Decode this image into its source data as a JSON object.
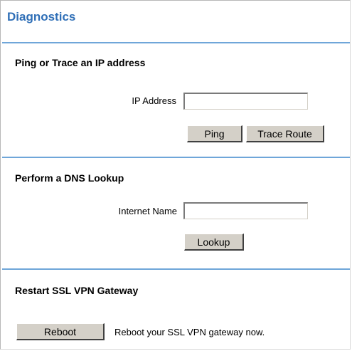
{
  "page": {
    "title": "Diagnostics"
  },
  "ping_section": {
    "title": "Ping or Trace an IP address",
    "ip_label": "IP Address",
    "ip_value": "",
    "ping_button": "Ping",
    "trace_button": "Trace Route"
  },
  "dns_section": {
    "title": "Perform a DNS Lookup",
    "name_label": "Internet Name",
    "name_value": "",
    "lookup_button": "Lookup"
  },
  "restart_section": {
    "title": "Restart SSL VPN Gateway",
    "reboot_button": "Reboot",
    "reboot_note": "Reboot your SSL VPN gateway now."
  },
  "colors": {
    "title": "#2f6fb7",
    "divider": "#6fa6d9",
    "button_face": "#d4d0c8"
  }
}
